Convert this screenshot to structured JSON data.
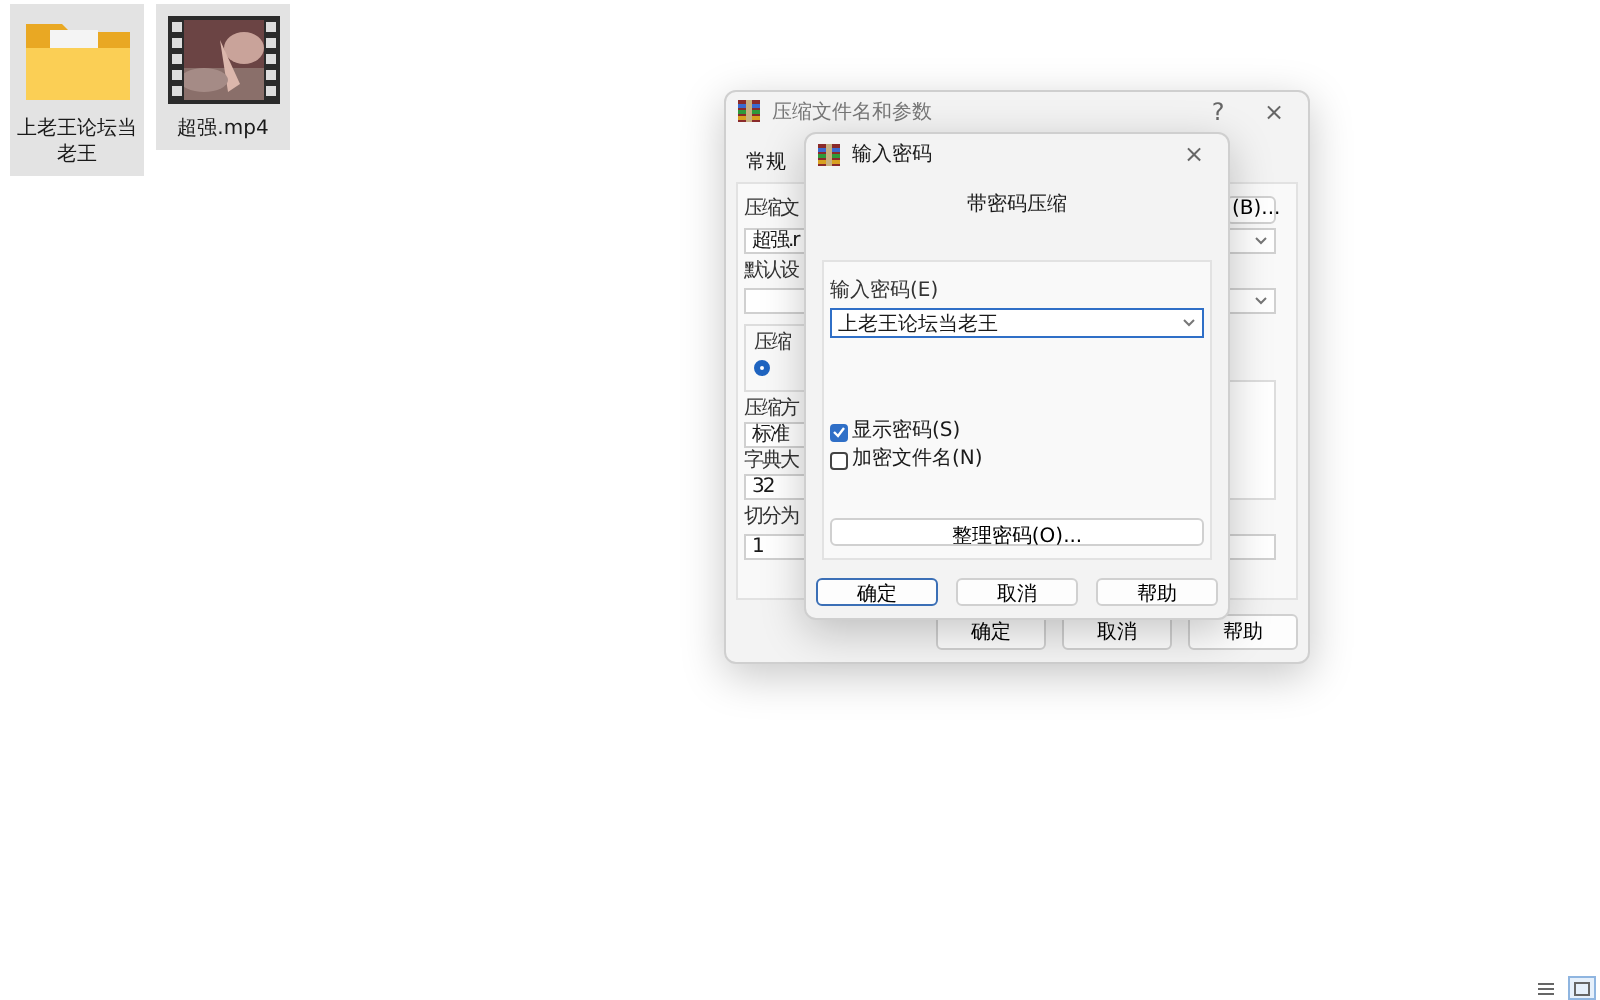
{
  "desktop": {
    "icons": [
      {
        "label": "上老王论坛当老王",
        "kind": "folder",
        "selected": true
      },
      {
        "label": "超强.mp4",
        "kind": "video",
        "selected": true
      }
    ]
  },
  "view_switch": [
    {
      "kind": "details",
      "selected": false
    },
    {
      "kind": "large_icons",
      "selected": true
    }
  ],
  "background_dialog": {
    "title": "压缩文件名和参数",
    "help": "?",
    "close": "×",
    "tab": "常规",
    "top_fields": [
      {
        "label": "压缩文",
        "value": "超强.r",
        "kind": "combo",
        "button": "(B)..."
      },
      {
        "label": "默认设",
        "kind": "combo"
      }
    ],
    "group": {
      "label": "压缩",
      "option_selected": true
    },
    "side_fields": [
      {
        "label": "压缩方",
        "value": "标准"
      },
      {
        "label": "字典大",
        "value": "32"
      }
    ],
    "bottom_fields": [
      {
        "label": "切分为",
        "value": "1"
      }
    ],
    "buttons": [
      "确定",
      "取消",
      "帮助"
    ]
  },
  "password_dialog": {
    "title": "输入密码",
    "close": "×",
    "heading": "带密码压缩",
    "password_label": "输入密码(E)",
    "password_value": "上老王论坛当老王",
    "options": [
      {
        "label": "显示密码(S)",
        "checked": true
      },
      {
        "label": "加密文件名(N)",
        "checked": false
      }
    ],
    "organize_button": "整理密码(O)...",
    "buttons": [
      {
        "label": "确定",
        "selected": true
      },
      {
        "label": "取消",
        "selected": false
      },
      {
        "label": "帮助",
        "selected": false
      }
    ]
  }
}
